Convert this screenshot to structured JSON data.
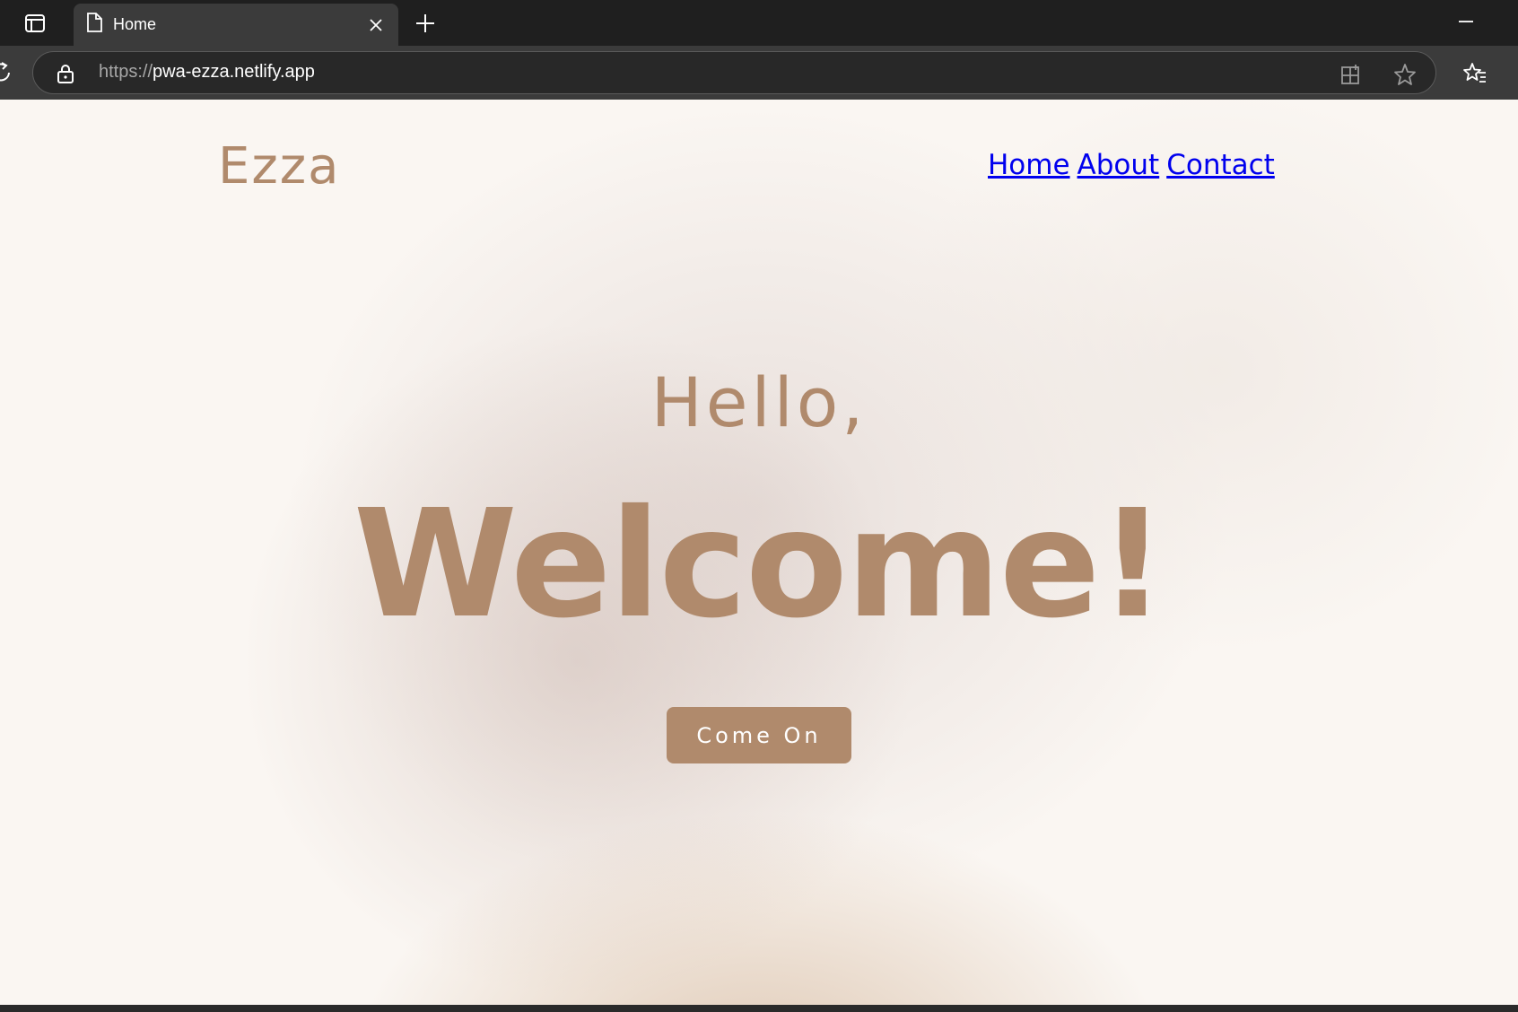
{
  "browser": {
    "tab_title": "Home",
    "url_protocol": "https://",
    "url_host": "pwa-ezza.netlify.app"
  },
  "page": {
    "brand": "Ezza",
    "nav": [
      "Home",
      "About",
      "Contact"
    ],
    "greeting": "Hello,",
    "headline": "Welcome!",
    "cta_label": "Come On"
  },
  "colors": {
    "accent": "#b08a6c",
    "link": "#0000ee",
    "chrome_dark": "#1f1f1f",
    "chrome_toolbar": "#3b3b3b"
  },
  "icons": {
    "tab_actions": "tab-actions-icon",
    "page": "page-icon",
    "close": "close-icon",
    "new_tab": "plus-icon",
    "minimize": "minimize-icon",
    "reload": "reload-icon",
    "lock": "lock-icon",
    "extensions": "app-extension-icon",
    "star": "star-icon",
    "favorites": "favorites-icon"
  }
}
